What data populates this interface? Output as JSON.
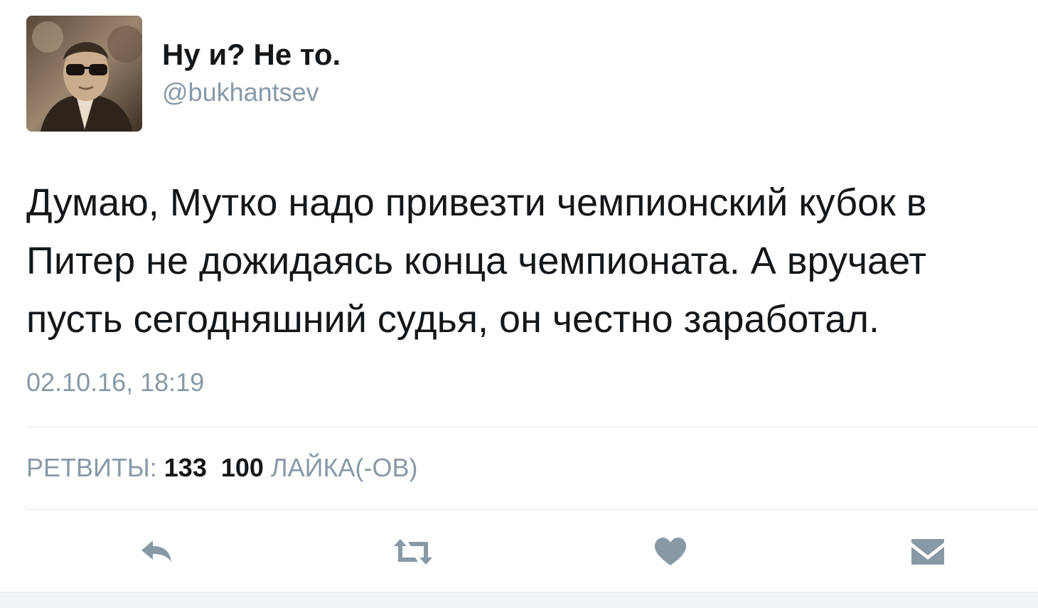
{
  "tweet": {
    "display_name": "Ну и? Не то.",
    "handle": "@bukhantsev",
    "text_lines": [
      "Думаю, Мутко надо привезти чемпионский кубок в",
      "Питер не дожидаясь конца чемпионата. А вручает",
      "пусть сегодняшний судья, он честно заработал."
    ],
    "timestamp": "02.10.16, 18:19"
  },
  "stats": {
    "retweets_label": "РЕТВИТЫ:",
    "retweets_count": "133",
    "likes_count": "100",
    "likes_label": "ЛАЙКА(-ОВ)"
  },
  "actions": {
    "icon_color": "#8899a6",
    "items": [
      "reply-icon",
      "retweet-icon",
      "heart-icon",
      "message-icon"
    ]
  }
}
